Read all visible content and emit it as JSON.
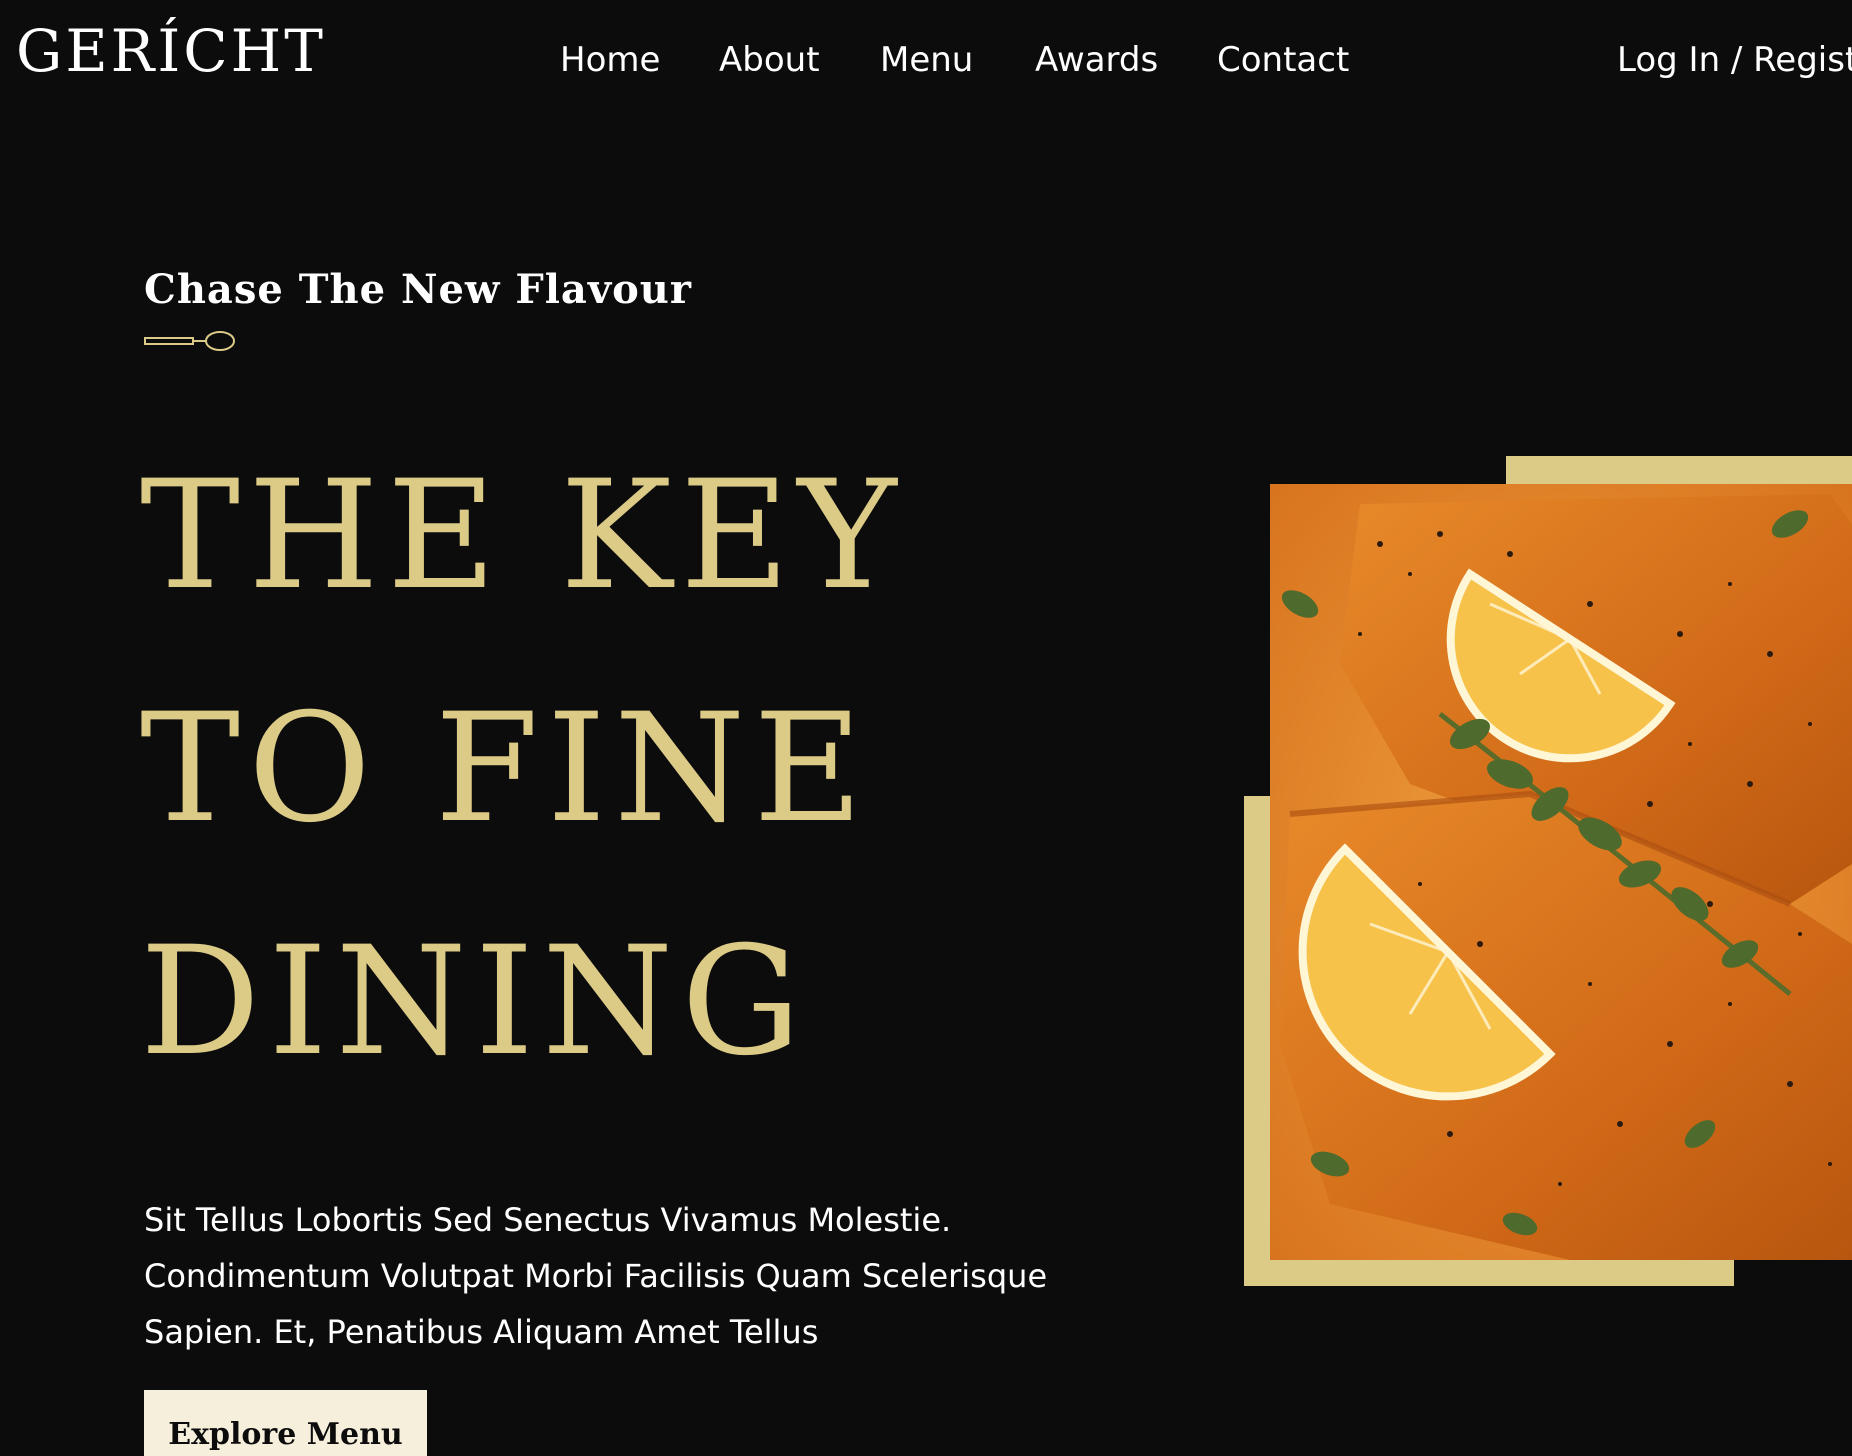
{
  "brand": {
    "logo": "GERÍCHT"
  },
  "nav": {
    "home": "Home",
    "about": "About",
    "menu": "Menu",
    "awards": "Awards",
    "contact": "Contact",
    "login": "Log In / Registr"
  },
  "hero": {
    "subtitle": "Chase The New Flavour",
    "headline_lines": [
      "THE KEY",
      "TO FINE",
      "DINING"
    ],
    "description": "Sit Tellus Lobortis Sed Senectus Vivamus Molestie. Condimentum Volutpat Morbi Facilisis Quam Scelerisque Sapien. Et, Penatibus Aliquam Amet Tellus",
    "cta_label": "Explore Menu",
    "image_alt": "Salmon fillets with lemon slices and fresh herbs"
  },
  "colors": {
    "background": "#0C0C0C",
    "gold": "#DCCA87",
    "text": "#FFFFFF",
    "button_bg": "#F5EFDB"
  }
}
